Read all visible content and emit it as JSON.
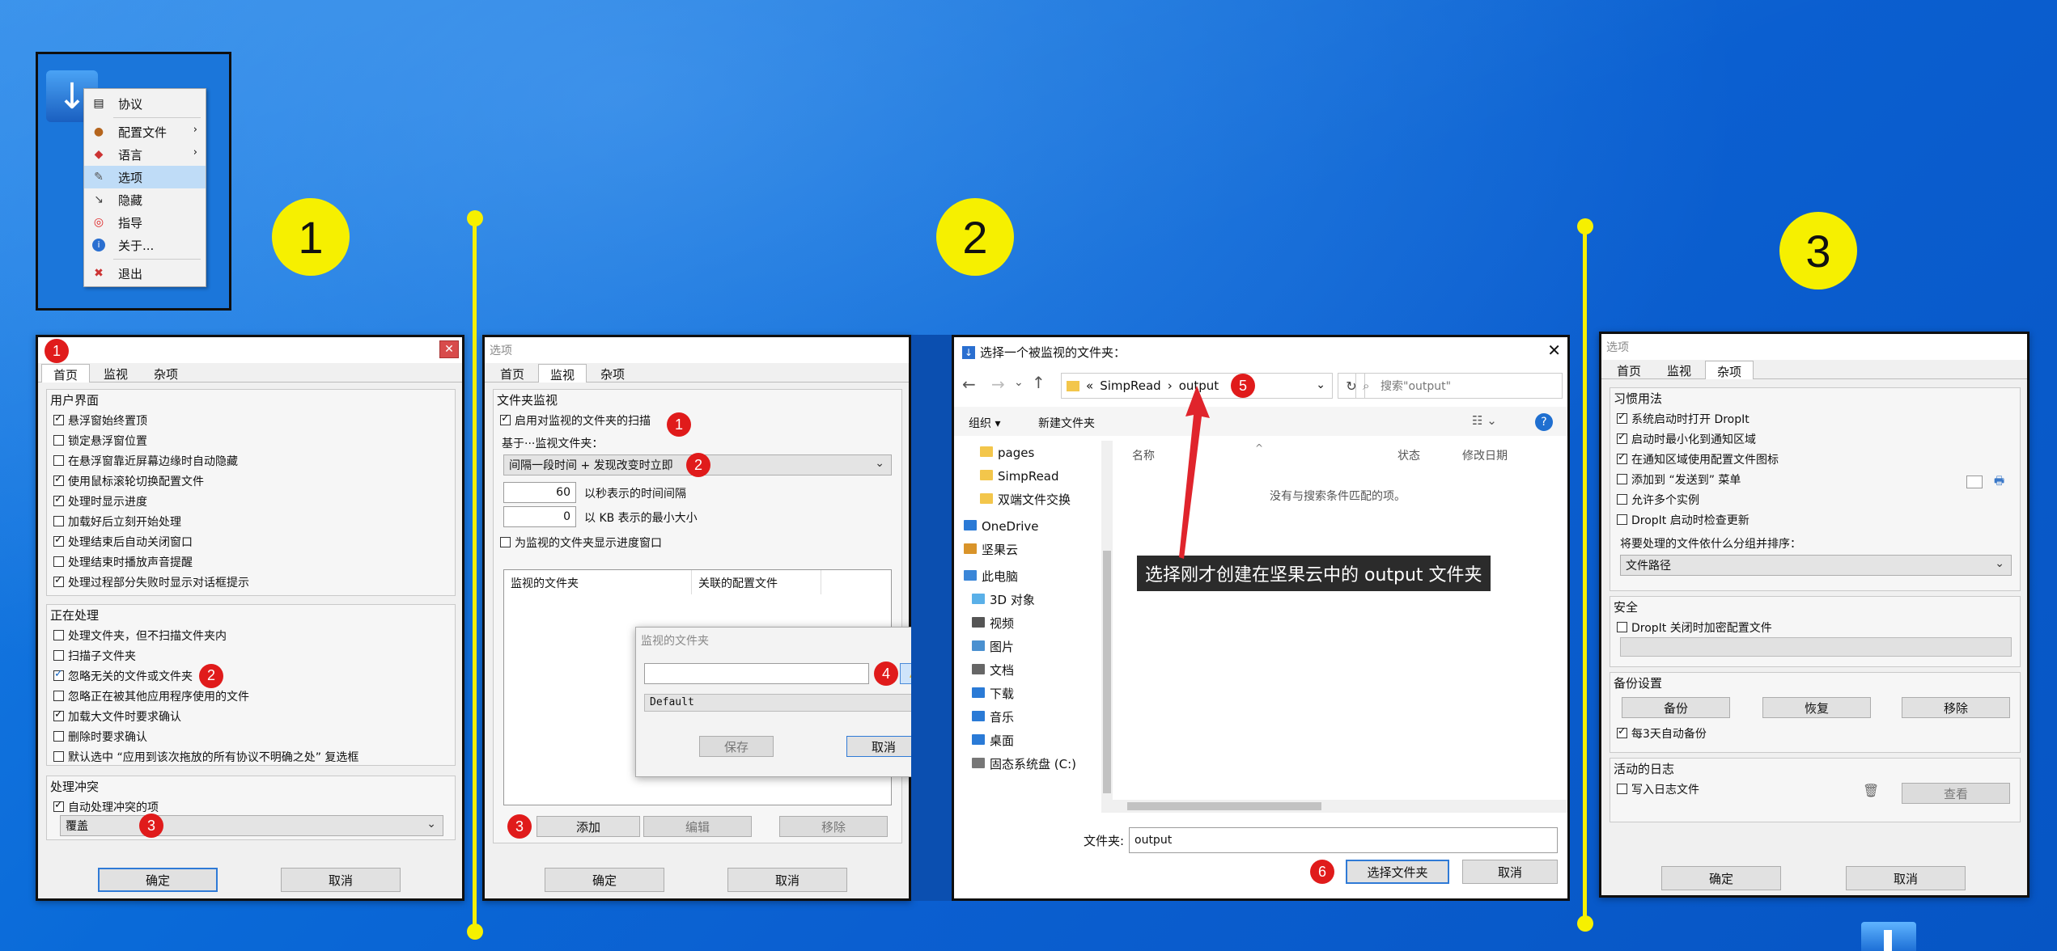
{
  "steps": [
    "1",
    "2",
    "3"
  ],
  "context_menu": {
    "items": [
      {
        "label": "协议",
        "icon": "agreement-icon"
      },
      {
        "label": "配置文件",
        "icon": "profile-icon",
        "submenu": true
      },
      {
        "label": "语言",
        "icon": "language-icon",
        "submenu": true
      },
      {
        "label": "选项",
        "icon": "options-icon",
        "selected": true
      },
      {
        "label": "隐藏",
        "icon": "hide-icon"
      },
      {
        "label": "指导",
        "icon": "guide-icon"
      },
      {
        "label": "关于...",
        "icon": "info-icon"
      },
      {
        "label": "退出",
        "icon": "exit-icon"
      }
    ]
  },
  "win1": {
    "badge": "1",
    "tabs": [
      "首页",
      "监视",
      "杂项"
    ],
    "group_user_ui": {
      "title": "用户界面",
      "items": [
        {
          "label": "悬浮窗始终置顶",
          "checked": true
        },
        {
          "label": "锁定悬浮窗位置",
          "checked": false
        },
        {
          "label": "在悬浮窗靠近屏幕边缘时自动隐藏",
          "checked": false
        },
        {
          "label": "使用鼠标滚轮切换配置文件",
          "checked": true
        },
        {
          "label": "处理时显示进度",
          "checked": true
        },
        {
          "label": "加载好后立刻开始处理",
          "checked": false
        },
        {
          "label": "处理结束后自动关闭窗口",
          "checked": true
        },
        {
          "label": "处理结束时播放声音提醒",
          "checked": false
        },
        {
          "label": "处理过程部分失败时显示对话框提示",
          "checked": true
        }
      ]
    },
    "group_processing": {
      "title": "正在处理",
      "items": [
        {
          "label": "处理文件夹，但不扫描文件夹内",
          "checked": false
        },
        {
          "label": "扫描子文件夹",
          "checked": false
        },
        {
          "label": "忽略无关的文件或文件夹",
          "checked": true,
          "badge": "2"
        },
        {
          "label": "忽略正在被其他应用程序使用的文件",
          "checked": false
        },
        {
          "label": "加载大文件时要求确认",
          "checked": true
        },
        {
          "label": "删除时要求确认",
          "checked": false
        },
        {
          "label": "默认选中 “应用到该次拖放的所有协议不明确之处” 复选框",
          "checked": false
        }
      ]
    },
    "group_conflict": {
      "title": "处理冲突",
      "auto_label": "自动处理冲突的项",
      "auto_checked": true,
      "select_value": "覆盖",
      "badge": "3"
    },
    "ok": "确定",
    "cancel": "取消"
  },
  "win2": {
    "title": "选项",
    "tabs": [
      "首页",
      "监视",
      "杂项"
    ],
    "group_title": "文件夹监视",
    "enable_label": "启用对监视的文件夹的扫描",
    "enable_checked": true,
    "badge1": "1",
    "based_on": "基于···监视文件夹：",
    "mode_value": "间隔一段时间 + 发现改变时立即",
    "badge2": "2",
    "interval_value": "60",
    "interval_label": "以秒表示的时间间隔",
    "minsize_value": "0",
    "minsize_label": "以 KB 表示的最小大小",
    "progress_label": "为监视的文件夹显示进度窗口",
    "progress_checked": false,
    "col_folder": "监视的文件夹",
    "col_profile": "关联的配置文件",
    "badge3": "3",
    "add": "添加",
    "edit": "编辑",
    "remove": "移除",
    "ok": "确定",
    "cancel": "取消",
    "sub": {
      "title": "监视的文件夹",
      "badge4": "4",
      "profile_value": "Default",
      "save": "保存",
      "cancel": "取消"
    }
  },
  "explorer": {
    "title": "选择一个被监视的文件夹：",
    "crumbs": [
      "«",
      "SimpRead",
      "›",
      "output"
    ],
    "badge5": "5",
    "search_placeholder": "搜索\"output\"",
    "organize": "组织 ▾",
    "new_folder": "新建文件夹",
    "nav": [
      {
        "label": "pages",
        "icon": "folder-icon"
      },
      {
        "label": "SimpRead",
        "icon": "folder-icon"
      },
      {
        "label": "双端文件交换",
        "icon": "folder-icon"
      },
      {
        "label": "OneDrive",
        "icon": "onedrive-icon"
      },
      {
        "label": "坚果云",
        "icon": "nutstore-icon"
      },
      {
        "label": "此电脑",
        "icon": "computer-icon"
      },
      {
        "label": "3D 对象",
        "icon": "3d-icon"
      },
      {
        "label": "视频",
        "icon": "video-icon"
      },
      {
        "label": "图片",
        "icon": "picture-icon"
      },
      {
        "label": "文档",
        "icon": "document-icon"
      },
      {
        "label": "下载",
        "icon": "download-icon"
      },
      {
        "label": "音乐",
        "icon": "music-icon"
      },
      {
        "label": "桌面",
        "icon": "desktop-icon"
      },
      {
        "label": "固态系统盘 (C:)",
        "icon": "drive-icon"
      }
    ],
    "col_name": "名称",
    "col_status": "状态",
    "col_date": "修改日期",
    "empty_text": "没有与搜索条件匹配的项。",
    "callout": "选择刚才创建在坚果云中的 output 文件夹",
    "folder_label": "文件夹:",
    "folder_value": "output",
    "badge6": "6",
    "select": "选择文件夹",
    "cancel": "取消"
  },
  "win3": {
    "title": "选项",
    "tabs": [
      "首页",
      "监视",
      "杂项"
    ],
    "group_habit": {
      "title": "习惯用法",
      "items": [
        {
          "label": "系统启动时打开 DropIt",
          "checked": true
        },
        {
          "label": "启动时最小化到通知区域",
          "checked": true
        },
        {
          "label": "在通知区域使用配置文件图标",
          "checked": true
        },
        {
          "label": "添加到 “发送到” 菜单",
          "checked": false
        },
        {
          "label": "允许多个实例",
          "checked": false
        },
        {
          "label": "DropIt 启动时检查更新",
          "checked": false
        }
      ],
      "group_by_label": "将要处理的文件依什么分组并排序：",
      "group_by_value": "文件路径"
    },
    "group_security": {
      "title": "安全",
      "encrypt_label": "DropIt 关闭时加密配置文件",
      "encrypt_checked": false
    },
    "group_backup": {
      "title": "备份设置",
      "backup": "备份",
      "restore": "恢复",
      "remove": "移除",
      "auto_label": "每3天自动备份",
      "auto_checked": true
    },
    "group_log": {
      "title": "活动的日志",
      "write_label": "写入日志文件",
      "write_checked": false,
      "view": "查看"
    },
    "ok": "确定",
    "cancel": "取消"
  }
}
